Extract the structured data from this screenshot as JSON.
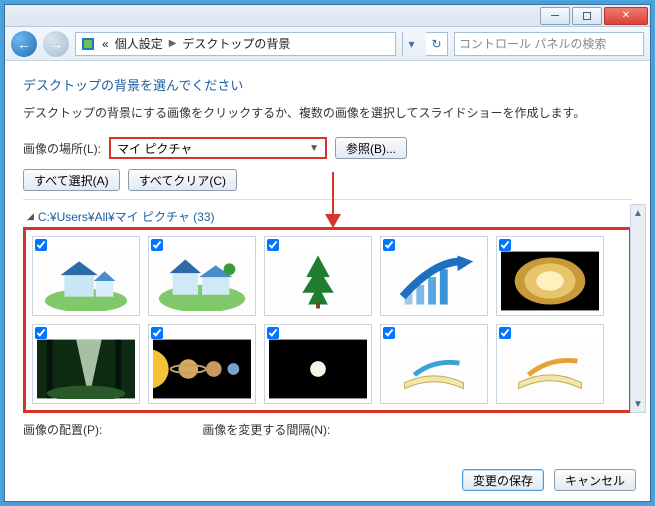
{
  "titlebar": {
    "minimize": "−",
    "maximize": "□",
    "close": "✕"
  },
  "nav": {
    "bc_prefix": "«",
    "bc_seg1": "個人設定",
    "bc_seg2": "デスクトップの背景",
    "search_placeholder": "コントロール パネルの検索"
  },
  "heading": "デスクトップの背景を選んでください",
  "desc": "デスクトップの背景にする画像をクリックするか、複数の画像を選択してスライドショーを作成します。",
  "loc_label": "画像の場所(L):",
  "loc_value": "マイ ピクチャ",
  "browse_btn": "参照(B)...",
  "select_all_btn": "すべて選択(A)",
  "clear_all_btn": "すべてクリア(C)",
  "group_title": "C:¥Users¥All¥マイ ピクチャ (33)",
  "thumbs": [
    {
      "id": "house-1",
      "checked": true
    },
    {
      "id": "house-2",
      "checked": true
    },
    {
      "id": "tree",
      "checked": true
    },
    {
      "id": "arrow-chart",
      "checked": true
    },
    {
      "id": "stage",
      "checked": true
    },
    {
      "id": "forest",
      "checked": true
    },
    {
      "id": "planets",
      "checked": true
    },
    {
      "id": "moon",
      "checked": true
    },
    {
      "id": "book-1",
      "checked": true
    },
    {
      "id": "book-2",
      "checked": true
    }
  ],
  "pos_label": "画像の配置(P):",
  "interval_label": "画像を変更する間隔(N):",
  "save_btn": "変更の保存",
  "cancel_btn": "キャンセル"
}
